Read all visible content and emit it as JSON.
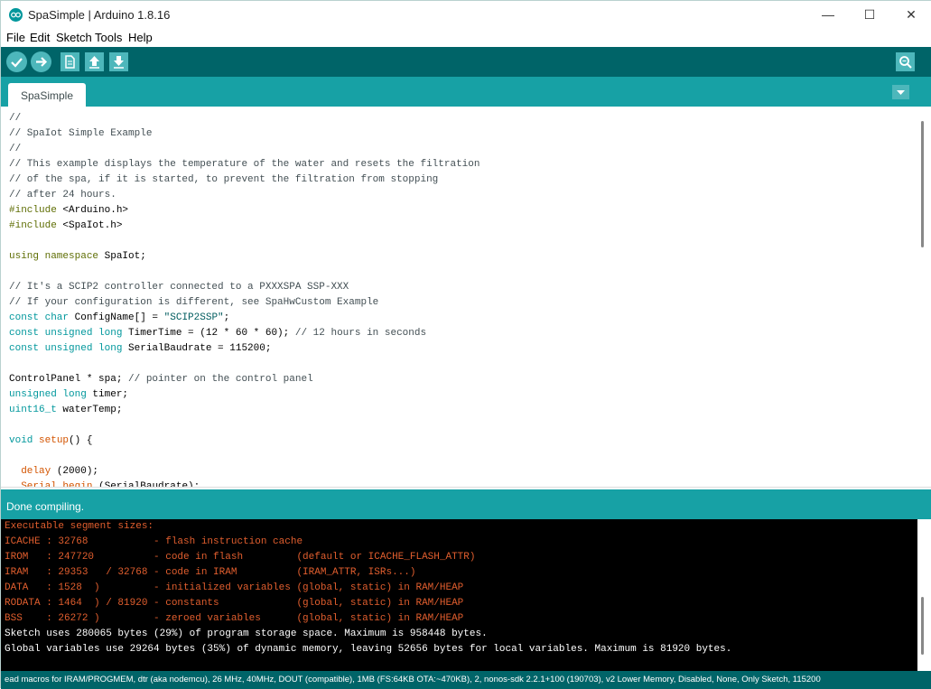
{
  "window": {
    "title": "SpaSimple | Arduino 1.8.16",
    "controls": {
      "minimize": "—",
      "maximize": "☐",
      "close": "✕"
    }
  },
  "menu": [
    "File",
    "Edit",
    "Sketch",
    "Tools",
    "Help"
  ],
  "toolbar": {
    "icons": [
      "verify-icon",
      "upload-icon",
      "new-icon",
      "open-icon",
      "save-icon",
      "serial-monitor-icon"
    ]
  },
  "tab": {
    "label": "SpaSimple"
  },
  "editor": {
    "lines": [
      [
        [
          "c",
          "//"
        ]
      ],
      [
        [
          "c",
          "// SpaIot Simple Example"
        ]
      ],
      [
        [
          "c",
          "//"
        ]
      ],
      [
        [
          "c",
          "// This example displays the temperature of the water and resets the filtration"
        ]
      ],
      [
        [
          "c",
          "// of the spa, if it is started, to prevent the filtration from stopping"
        ]
      ],
      [
        [
          "c",
          "// after 24 hours."
        ]
      ],
      [
        [
          "p",
          "#include"
        ],
        [
          "n",
          " <Arduino.h>"
        ]
      ],
      [
        [
          "p",
          "#include"
        ],
        [
          "n",
          " <SpaIot.h>"
        ]
      ],
      [],
      [
        [
          "p",
          "using namespace"
        ],
        [
          "n",
          " SpaIot;"
        ]
      ],
      [],
      [
        [
          "c",
          "// It's a SCIP2 controller connected to a PXXXSPA SSP-XXX"
        ]
      ],
      [
        [
          "c",
          "// If your configuration is different, see SpaHwCustom Example"
        ]
      ],
      [
        [
          "t",
          "const char"
        ],
        [
          "n",
          " ConfigName[] = "
        ],
        [
          "s",
          "\"SCIP2SSP\""
        ],
        [
          "n",
          ";"
        ]
      ],
      [
        [
          "t",
          "const unsigned long"
        ],
        [
          "n",
          " TimerTime = (12 * 60 * 60); "
        ],
        [
          "c",
          "// 12 hours in seconds"
        ]
      ],
      [
        [
          "t",
          "const unsigned long"
        ],
        [
          "n",
          " SerialBaudrate = 115200;"
        ]
      ],
      [],
      [
        [
          "n",
          "ControlPanel * spa; "
        ],
        [
          "c",
          "// pointer on the control panel"
        ]
      ],
      [
        [
          "t",
          "unsigned long"
        ],
        [
          "n",
          " timer;"
        ]
      ],
      [
        [
          "t",
          "uint16_t"
        ],
        [
          "n",
          " waterTemp;"
        ]
      ],
      [],
      [
        [
          "t",
          "void"
        ],
        [
          "n",
          " "
        ],
        [
          "f",
          "setup"
        ],
        [
          "n",
          "() {"
        ]
      ],
      [],
      [
        [
          "n",
          "  "
        ],
        [
          "f",
          "delay"
        ],
        [
          "n",
          " (2000);"
        ]
      ],
      [
        [
          "n",
          "  "
        ],
        [
          "f",
          "Serial"
        ],
        [
          "n",
          "."
        ],
        [
          "f",
          "begin"
        ],
        [
          "n",
          " (SerialBaudrate);"
        ]
      ]
    ]
  },
  "status": {
    "text": "Done compiling."
  },
  "console": {
    "lines": [
      {
        "kind": "warn",
        "text": "Executable segment sizes:"
      },
      {
        "kind": "warn",
        "text": "ICACHE : 32768           - flash instruction cache"
      },
      {
        "kind": "warn",
        "text": "IROM   : 247720          - code in flash         (default or ICACHE_FLASH_ATTR)"
      },
      {
        "kind": "warn",
        "text": "IRAM   : 29353   / 32768 - code in IRAM          (IRAM_ATTR, ISRs...)"
      },
      {
        "kind": "warn",
        "text": "DATA   : 1528  )         - initialized variables (global, static) in RAM/HEAP"
      },
      {
        "kind": "warn",
        "text": "RODATA : 1464  ) / 81920 - constants             (global, static) in RAM/HEAP"
      },
      {
        "kind": "warn",
        "text": "BSS    : 26272 )         - zeroed variables      (global, static) in RAM/HEAP"
      },
      {
        "kind": "info",
        "text": "Sketch uses 280065 bytes (29%) of program storage space. Maximum is 958448 bytes."
      },
      {
        "kind": "info",
        "text": "Global variables use 29264 bytes (35%) of dynamic memory, leaving 52656 bytes for local variables. Maximum is 81920 bytes."
      }
    ]
  },
  "board": {
    "text": "ead macros for IRAM/PROGMEM, dtr (aka nodemcu), 26 MHz, 40MHz, DOUT (compatible), 1MB (FS:64KB OTA:~470KB), 2, nonos-sdk 2.2.1+100 (190703), v2 Lower Memory, Disabled, None, Only Sketch, 115200"
  },
  "colors": {
    "toolbar": "#006468",
    "accent": "#17a1a5",
    "button": "#4db7bb",
    "console_warn": "#e15e2e"
  }
}
